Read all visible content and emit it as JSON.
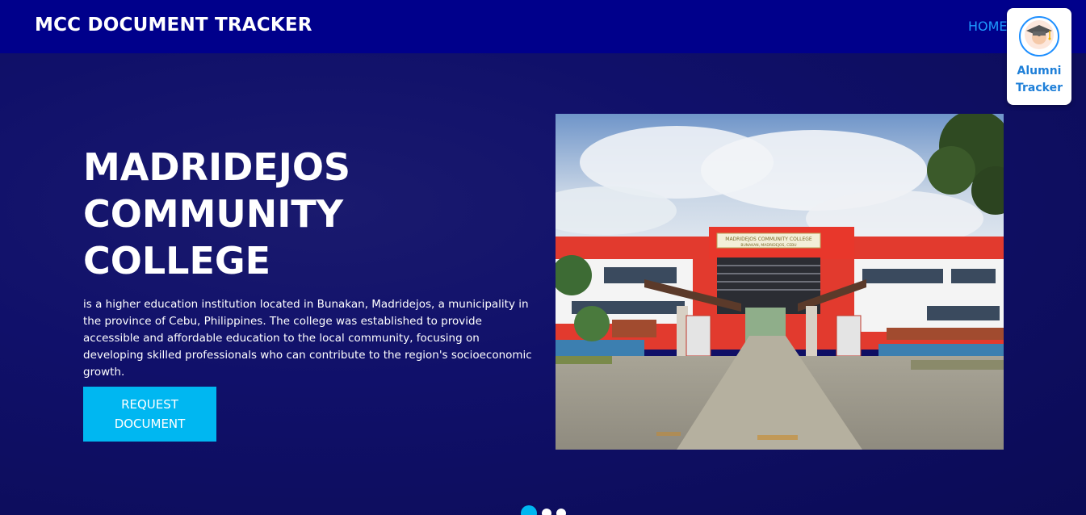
{
  "navbar": {
    "brand": "MCC DOCUMENT TRACKER",
    "home_link": "HOME"
  },
  "alumni_card": {
    "icon": "graduation-cap-icon",
    "label": "Alumni\nTracker"
  },
  "hero": {
    "title": "MADRIDEJOS\nCOMMUNITY\nCOLLEGE",
    "description": "is a higher education institution located in Bunakan, Madridejos, a municipality in the province of Cebu, Philippines. The college was established to provide accessible and affordable education to the local community, focusing on developing skilled professionals who can contribute to the region's socioeconomic growth.",
    "cta_label": "REQUEST\nDOCUMENT",
    "photo_sign_line1": "MADRIDEJOS COMMUNITY COLLEGE",
    "photo_sign_line2": "BUNAKAN, MADRIDEJOS, CEBU"
  },
  "carousel": {
    "slides": 3,
    "active_index": 0
  },
  "colors": {
    "navbar": "#00008b",
    "accent": "#00b7f1",
    "home_link": "#1e9bff",
    "alumni_text": "#1e7fd8"
  }
}
